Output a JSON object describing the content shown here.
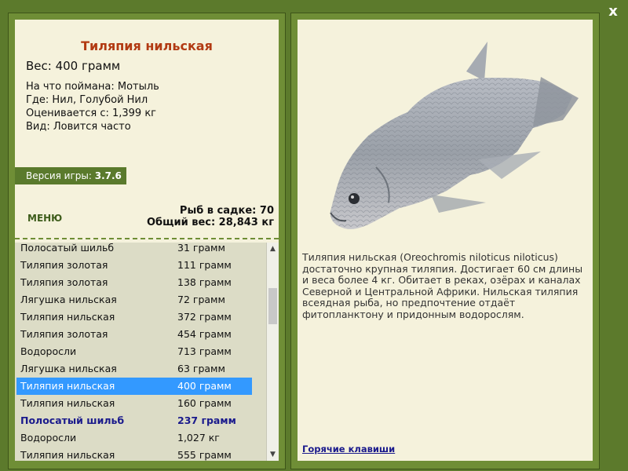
{
  "close": {
    "label": "x"
  },
  "fish": {
    "title": "Тиляпия нильская",
    "weight": "Вес: 400 грамм",
    "info": [
      "На что поймана: Мотыль",
      "Где: Нил, Голубой Нил",
      "Оценивается с: 1,399 кг",
      "Вид: Ловится часто"
    ],
    "description": "Тиляпия нильская (Oreochromis niloticus niloticus) достаточно крупная тиляпия. Достигает 60 см длины и веса более 4 кг. Обитает в реках, озёрах и каналах Северной и Центральной Африки. Нильская тиляпия всеядная рыба, но предпочтение отдаёт фитопланктону и придонным водорослям."
  },
  "version": {
    "label": "Версия игры: ",
    "value": "3.7.6"
  },
  "menu": {
    "label": "МЕНЮ"
  },
  "stats": {
    "cage": "Рыб в садке: 70",
    "total": "Общий вес: 28,843 кг"
  },
  "catches": [
    {
      "name": "Полосатый шильб",
      "weight": "31 грамм"
    },
    {
      "name": "Тиляпия золотая",
      "weight": "111 грамм"
    },
    {
      "name": "Тиляпия золотая",
      "weight": "138 грамм"
    },
    {
      "name": "Лягушка нильская",
      "weight": "72 грамм"
    },
    {
      "name": "Тиляпия нильская",
      "weight": "372 грамм"
    },
    {
      "name": "Тиляпия золотая",
      "weight": "454 грамм"
    },
    {
      "name": "Водоросли",
      "weight": "713 грамм"
    },
    {
      "name": "Лягушка нильская",
      "weight": "63 грамм"
    },
    {
      "name": "Тиляпия нильская",
      "weight": "400 грамм",
      "state": "selected"
    },
    {
      "name": "Тиляпия нильская",
      "weight": "160 грамм"
    },
    {
      "name": "Полосатый шильб",
      "weight": "237 грамм",
      "state": "bold"
    },
    {
      "name": "Водоросли",
      "weight": "1,027 кг"
    },
    {
      "name": "Тиляпия нильская",
      "weight": "555 грамм"
    }
  ],
  "hotkeys": {
    "label": "Горячие клавиши"
  },
  "colors": {
    "frame": "#6f8e36",
    "panel": "#f5f2dc",
    "title": "#b23a12",
    "selected_row": "#3399ff",
    "link": "#1a1a8c"
  },
  "icons": {
    "close": "close-icon",
    "scroll_up": "scroll-up-arrow-icon",
    "scroll_down": "scroll-down-arrow-icon"
  }
}
